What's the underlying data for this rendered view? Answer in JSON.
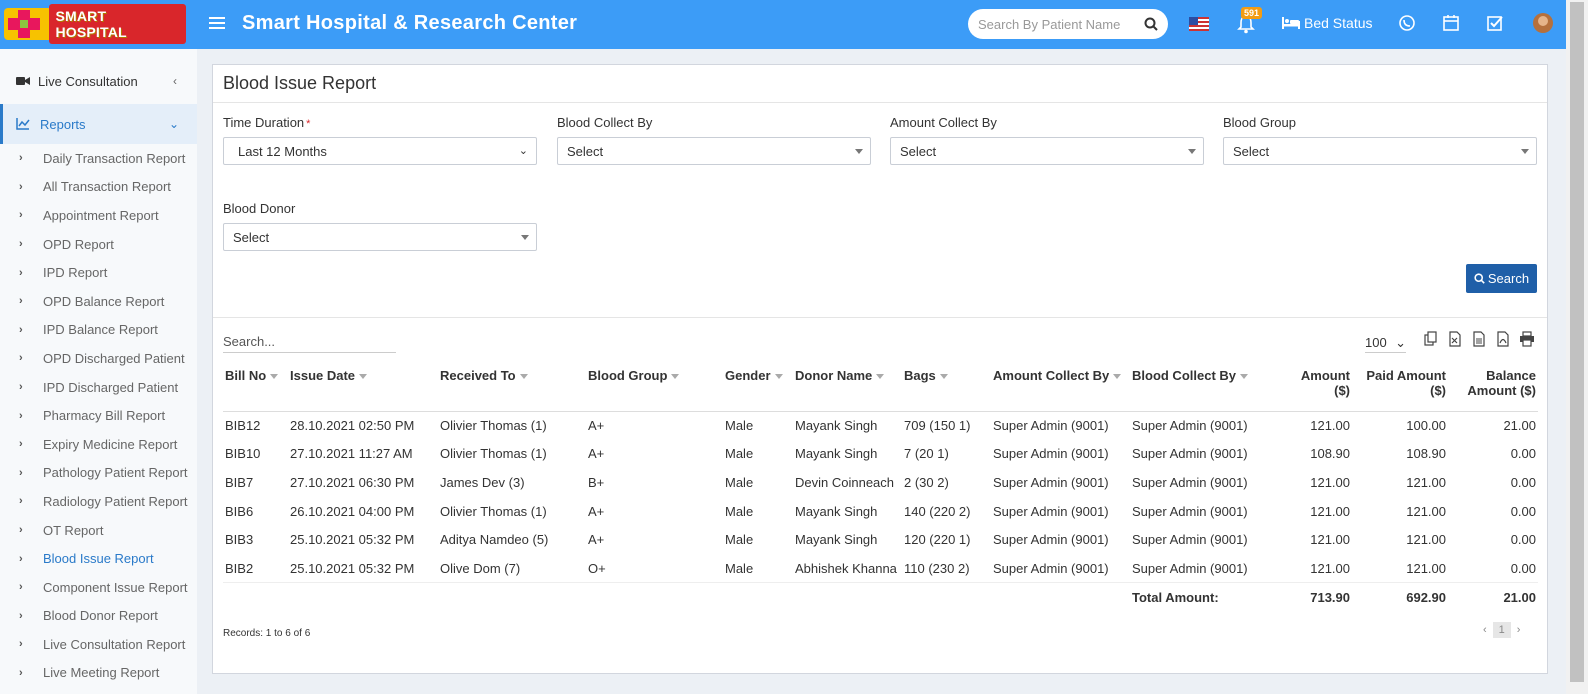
{
  "header": {
    "logo_text": "SMART HOSPITAL",
    "title": "Smart Hospital & Research Center",
    "search_placeholder": "Search By Patient Name",
    "notification_count": "591",
    "bed_status": "Bed Status"
  },
  "sidebar": {
    "live_consultation": "Live Consultation",
    "reports": "Reports",
    "items": [
      "Daily Transaction Report",
      "All Transaction Report",
      "Appointment Report",
      "OPD Report",
      "IPD Report",
      "OPD Balance Report",
      "IPD Balance Report",
      "OPD Discharged Patient",
      "IPD Discharged Patient",
      "Pharmacy Bill Report",
      "Expiry Medicine Report",
      "Pathology Patient Report",
      "Radiology Patient Report",
      "OT Report",
      "Blood Issue Report",
      "Component Issue Report",
      "Blood Donor Report",
      "Live Consultation Report",
      "Live Meeting Report"
    ],
    "active_index": 14
  },
  "page": {
    "title": "Blood Issue Report",
    "filters": {
      "time_duration_label": "Time Duration",
      "time_duration_value": "Last 12 Months",
      "blood_collect_by_label": "Blood Collect By",
      "blood_collect_by_value": "Select",
      "amount_collect_by_label": "Amount Collect By",
      "amount_collect_by_value": "Select",
      "blood_group_label": "Blood Group",
      "blood_group_value": "Select",
      "blood_donor_label": "Blood Donor",
      "blood_donor_value": "Select",
      "search_button": "Search"
    },
    "table_search_placeholder": "Search...",
    "page_length": "100",
    "columns": [
      "Bill No",
      "Issue Date",
      "Received To",
      "Blood Group",
      "Gender",
      "Donor Name",
      "Bags",
      "Amount Collect By",
      "Blood Collect By",
      "Amount ($)",
      "Paid Amount ($)",
      "Balance Amount ($)"
    ],
    "rows": [
      [
        "BIB12",
        "28.10.2021 02:50 PM",
        "Olivier Thomas (1)",
        "A+",
        "Male",
        "Mayank Singh",
        "709 (150 1)",
        "Super Admin (9001)",
        "Super Admin (9001)",
        "121.00",
        "100.00",
        "21.00"
      ],
      [
        "BIB10",
        "27.10.2021 11:27 AM",
        "Olivier Thomas (1)",
        "A+",
        "Male",
        "Mayank Singh",
        "7 (20 1)",
        "Super Admin (9001)",
        "Super Admin (9001)",
        "108.90",
        "108.90",
        "0.00"
      ],
      [
        "BIB7",
        "27.10.2021 06:30 PM",
        "James Dev (3)",
        "B+",
        "Male",
        "Devin Coinneach",
        "2 (30 2)",
        "Super Admin (9001)",
        "Super Admin (9001)",
        "121.00",
        "121.00",
        "0.00"
      ],
      [
        "BIB6",
        "26.10.2021 04:00 PM",
        "Olivier Thomas (1)",
        "A+",
        "Male",
        "Mayank Singh",
        "140 (220 2)",
        "Super Admin (9001)",
        "Super Admin (9001)",
        "121.00",
        "121.00",
        "0.00"
      ],
      [
        "BIB3",
        "25.10.2021 05:32 PM",
        "Aditya Namdeo (5)",
        "A+",
        "Male",
        "Mayank Singh",
        "120 (220 1)",
        "Super Admin (9001)",
        "Super Admin (9001)",
        "121.00",
        "121.00",
        "0.00"
      ],
      [
        "BIB2",
        "25.10.2021 05:32 PM",
        "Olive Dom (7)",
        "O+",
        "Male",
        "Abhishek Khanna",
        "110 (230 2)",
        "Super Admin (9001)",
        "Super Admin (9001)",
        "121.00",
        "121.00",
        "0.00"
      ]
    ],
    "total_label": "Total Amount:",
    "total_amount": "713.90",
    "total_paid": "692.90",
    "total_balance": "21.00",
    "records_text": "Records: 1 to 6 of 6",
    "current_page": "1"
  }
}
